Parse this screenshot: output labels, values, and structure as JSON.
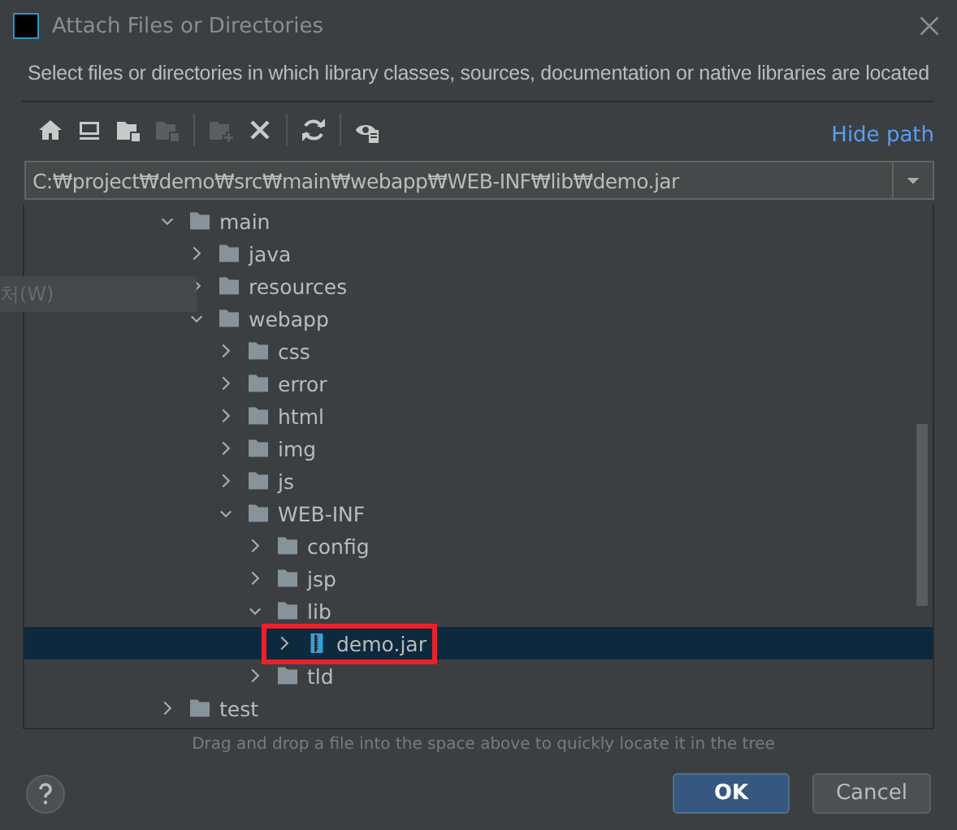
{
  "window": {
    "title": "Attach Files or Directories"
  },
  "description": "Select files or directories in which library classes, sources, documentation or native libraries are located",
  "toolbar": [
    {
      "kind": "home",
      "disabled": false
    },
    {
      "kind": "desktop",
      "disabled": false
    },
    {
      "kind": "project",
      "disabled": false
    },
    {
      "kind": "module",
      "disabled": true
    },
    {
      "kind": "separator"
    },
    {
      "kind": "new-folder",
      "disabled": true
    },
    {
      "kind": "delete",
      "disabled": false
    },
    {
      "kind": "separator"
    },
    {
      "kind": "refresh",
      "disabled": false
    },
    {
      "kind": "separator"
    },
    {
      "kind": "show-hidden",
      "disabled": false
    }
  ],
  "hide_path_link": "Hide path",
  "path_field": {
    "value": "C:₩project₩demo₩src₩main₩webapp₩WEB-INF₩lib₩demo.jar"
  },
  "ghost_label": "처(W)",
  "tree": [
    {
      "label": "main",
      "kind": "folder",
      "expanded": true,
      "selected": false,
      "children": [
        {
          "label": "java",
          "kind": "folder",
          "expanded": false,
          "selected": false
        },
        {
          "label": "resources",
          "kind": "folder",
          "expanded": false,
          "selected": false
        },
        {
          "label": "webapp",
          "kind": "folder",
          "expanded": true,
          "selected": false,
          "children": [
            {
              "label": "css",
              "kind": "folder",
              "expanded": false,
              "selected": false
            },
            {
              "label": "error",
              "kind": "folder",
              "expanded": false,
              "selected": false
            },
            {
              "label": "html",
              "kind": "folder",
              "expanded": false,
              "selected": false
            },
            {
              "label": "img",
              "kind": "folder",
              "expanded": false,
              "selected": false
            },
            {
              "label": "js",
              "kind": "folder",
              "expanded": false,
              "selected": false
            },
            {
              "label": "WEB-INF",
              "kind": "folder",
              "expanded": true,
              "selected": false,
              "children": [
                {
                  "label": "config",
                  "kind": "folder",
                  "expanded": false,
                  "selected": false
                },
                {
                  "label": "jsp",
                  "kind": "folder",
                  "expanded": false,
                  "selected": false
                },
                {
                  "label": "lib",
                  "kind": "folder",
                  "expanded": true,
                  "selected": false,
                  "children": [
                    {
                      "label": "demo.jar",
                      "kind": "jar",
                      "expanded": false,
                      "selected": true,
                      "highlighted": true
                    }
                  ]
                },
                {
                  "label": "tld",
                  "kind": "folder",
                  "expanded": false,
                  "selected": false
                }
              ]
            }
          ]
        }
      ]
    },
    {
      "label": "test",
      "kind": "folder",
      "expanded": false,
      "selected": false
    }
  ],
  "drag_hint": "Drag and drop a file into the space above to quickly locate it in the tree",
  "buttons": [
    {
      "label": "OK",
      "kind": "default"
    },
    {
      "label": "Cancel",
      "kind": "normal"
    }
  ]
}
